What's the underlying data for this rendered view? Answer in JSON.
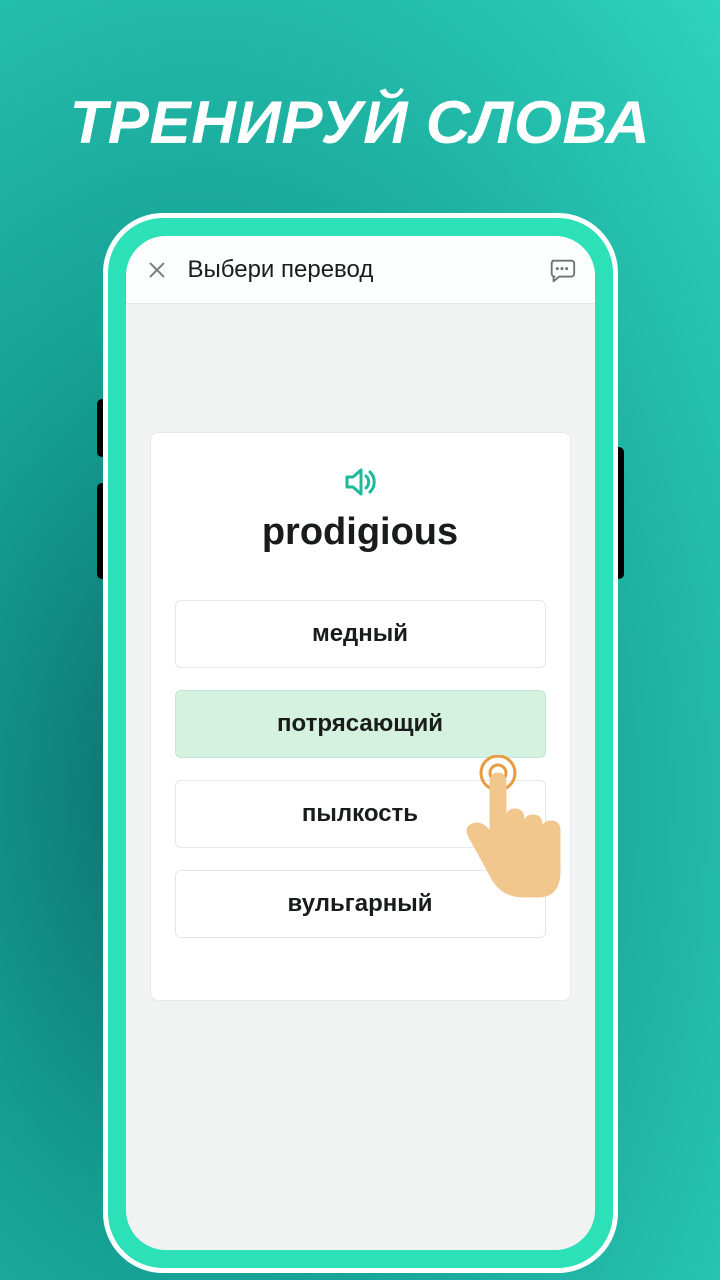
{
  "hero": {
    "title": "ТРЕНИРУЙ СЛОВА"
  },
  "appbar": {
    "title": "Выбери перевод"
  },
  "card": {
    "word": "prodigious",
    "options": [
      {
        "label": "медный",
        "selected": false
      },
      {
        "label": "потрясающий",
        "selected": true
      },
      {
        "label": "пылкость",
        "selected": false
      },
      {
        "label": "вульгарный",
        "selected": false
      }
    ]
  },
  "colors": {
    "accent": "#1fb89a"
  }
}
